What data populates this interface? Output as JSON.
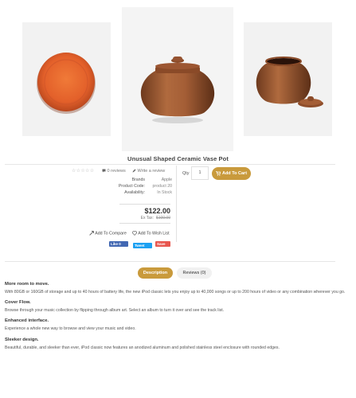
{
  "product": {
    "title": "Unusual Shaped Ceramic Vase Pot",
    "images": [
      {
        "icon": "orange-plate-image"
      },
      {
        "icon": "brown-lidded-pot-image"
      },
      {
        "icon": "brown-pot-with-lid-beside-image"
      }
    ]
  },
  "rating": {
    "stars": "☆☆☆☆☆",
    "reviews_label": "0 reviews",
    "write_label": "Write a review"
  },
  "specs": [
    {
      "key": "Brands",
      "value": "Apple"
    },
    {
      "key": "Product Code:",
      "value": "product 20"
    },
    {
      "key": "Availability:",
      "value": "In Stock"
    }
  ],
  "price": {
    "current": "$122.00",
    "ex_tax_label": "Ex Tax:",
    "ex_tax_value": "$100.00"
  },
  "actions": {
    "compare_label": "Add To Compare",
    "wishlist_label": "Add To Wish List"
  },
  "social": {
    "facebook": "Like 0",
    "twitter": "Tweet",
    "save": "Save"
  },
  "cart": {
    "qty_label": "Qty",
    "qty_value": "1",
    "button_label": "Add To Cart"
  },
  "tabs": [
    {
      "label": "Description",
      "active": true
    },
    {
      "label": "Reviews (0)",
      "active": false
    }
  ],
  "description": [
    {
      "heading": "More room to move.",
      "text": "With 80GB or 160GB of storage and up to 40 hours of battery life, the new iPod classic lets you enjoy up to 40,000 songs or up to 200 hours of video or any combination wherever you go."
    },
    {
      "heading": "Cover Flow.",
      "text": "Browse through your music collection by flipping through album art. Select an album to turn it over and see the track list."
    },
    {
      "heading": "Enhanced interface.",
      "text": "Experience a whole new way to browse and view your music and video."
    },
    {
      "heading": "Sleeker design.",
      "text": "Beautiful, durable, and sleeker than ever, iPod classic now features an anodized aluminum and polished stainless steel enclosure with rounded edges."
    }
  ],
  "colors": {
    "accent": "#c99a3c",
    "pot_brown": "#a45e36",
    "plate_orange": "#e8642a"
  }
}
